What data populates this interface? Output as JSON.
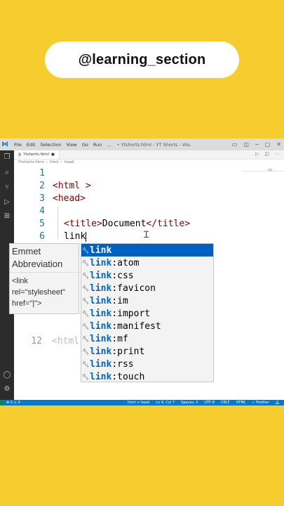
{
  "handle": "@learning_section",
  "window": {
    "menu": [
      "File",
      "Edit",
      "Selection",
      "View",
      "Go",
      "Run",
      "..."
    ],
    "title": "• Ytshorts.html - YT Shorts - Visual Studio Code",
    "tab_label": "Ytshorts.html",
    "breadcrumb": [
      "Ytshorts.html",
      "html",
      "head"
    ]
  },
  "editor": {
    "line_numbers": [
      "1",
      "2",
      "3",
      "4",
      "5",
      "6",
      "12"
    ],
    "lines": {
      "l2": "<html >",
      "l3": "<head>",
      "l5_open": "<title>",
      "l5_text": "Document",
      "l5_close": "</title>",
      "l6": "link"
    },
    "behind_text": "<html"
  },
  "hint": {
    "title": "Emmet Abbreviation",
    "snippet": "<link rel=\"stylesheet\" href=\"|\">"
  },
  "suggestions": [
    {
      "match": "link",
      "rest": "",
      "selected": true
    },
    {
      "match": "link",
      "rest": ":atom"
    },
    {
      "match": "link",
      "rest": ":css"
    },
    {
      "match": "link",
      "rest": ":favicon"
    },
    {
      "match": "link",
      "rest": ":im"
    },
    {
      "match": "link",
      "rest": ":import"
    },
    {
      "match": "link",
      "rest": ":manifest"
    },
    {
      "match": "link",
      "rest": ":mf"
    },
    {
      "match": "link",
      "rest": ":print"
    },
    {
      "match": "link",
      "rest": ":rss"
    },
    {
      "match": "link",
      "rest": ":touch"
    }
  ],
  "status": {
    "left": "⊗ 0 ⚠ 0",
    "right": [
      "html > head",
      "Ln 6, Col 7",
      "Spaces: 2",
      "UTF-8",
      "CRLF",
      "HTML",
      "✓ Prettier"
    ]
  },
  "colors": {
    "background": "#f7cc2f",
    "statusbar": "#007acc",
    "selection": "#0060c0",
    "tag": "#800000",
    "line_number": "#237893"
  }
}
